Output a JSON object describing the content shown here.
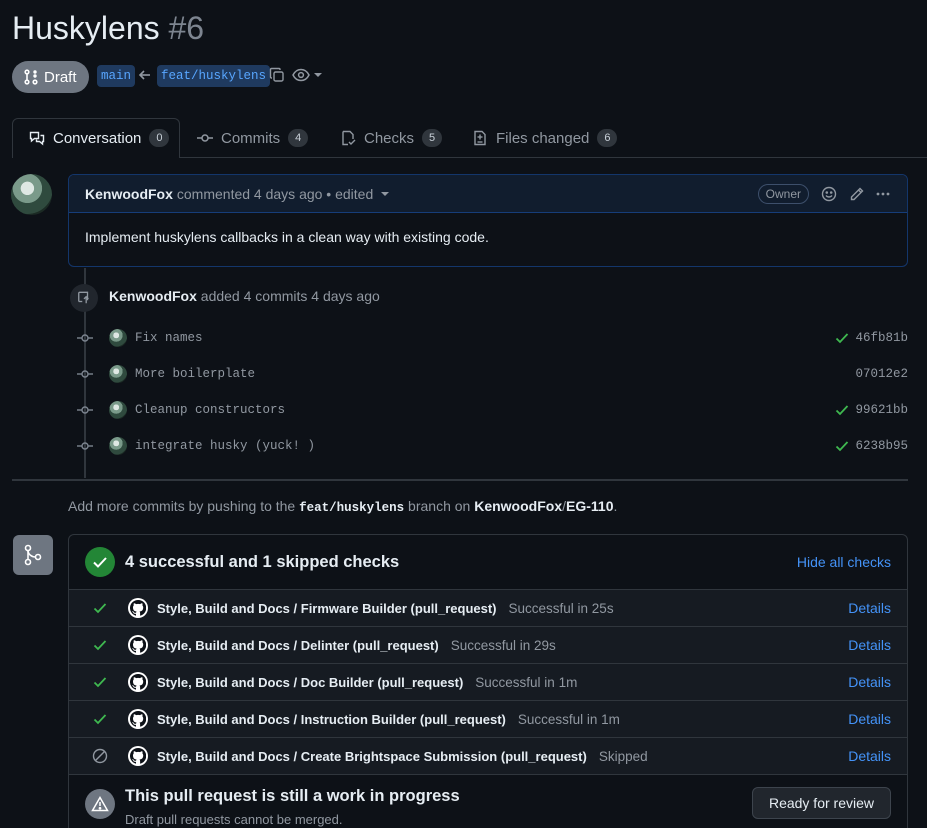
{
  "pr": {
    "title": "Huskylens",
    "number": "#6",
    "state": "Draft",
    "base_branch": "main",
    "head_branch": "feat/huskylens"
  },
  "tabs": [
    {
      "label": "Conversation",
      "count": "0",
      "icon": "comment-discussion-icon"
    },
    {
      "label": "Commits",
      "count": "4",
      "icon": "git-commit-icon"
    },
    {
      "label": "Checks",
      "count": "5",
      "icon": "checklist-icon"
    },
    {
      "label": "Files changed",
      "count": "6",
      "icon": "file-diff-icon"
    }
  ],
  "comment": {
    "author": "KenwoodFox",
    "meta": "commented 4 days ago • edited",
    "role": "Owner",
    "body": "Implement huskylens callbacks in a clean way with existing code."
  },
  "commit_event": {
    "author": "KenwoodFox",
    "text": "added 4 commits 4 days ago"
  },
  "commits": [
    {
      "message": "Fix names",
      "sha": "46fb81b",
      "status": "success"
    },
    {
      "message": "More boilerplate",
      "sha": "07012e2",
      "status": "none"
    },
    {
      "message": "Cleanup constructors",
      "sha": "99621bb",
      "status": "success"
    },
    {
      "message": "integrate husky (yuck! )",
      "sha": "6238b95",
      "status": "success"
    }
  ],
  "push_hint": {
    "prefix": "Add more commits by pushing to the",
    "branch": "feat/huskylens",
    "middle": "branch on",
    "owner": "KenwoodFox",
    "sep": "/",
    "repo": "EG-110",
    "suffix": "."
  },
  "checks_summary": {
    "title": "4 successful and 1 skipped checks",
    "toggle": "Hide all checks"
  },
  "checks": [
    {
      "workflow": "Style, Build and Docs / Firmware Builder (pull_request)",
      "desc": "Successful in 25s",
      "status": "success",
      "link": "Details"
    },
    {
      "workflow": "Style, Build and Docs / Delinter (pull_request)",
      "desc": "Successful in 29s",
      "status": "success",
      "link": "Details"
    },
    {
      "workflow": "Style, Build and Docs / Doc Builder (pull_request)",
      "desc": "Successful in 1m",
      "status": "success",
      "link": "Details"
    },
    {
      "workflow": "Style, Build and Docs / Instruction Builder (pull_request)",
      "desc": "Successful in 1m",
      "status": "success",
      "link": "Details"
    },
    {
      "workflow": "Style, Build and Docs / Create Brightspace Submission (pull_request)",
      "desc": "Skipped",
      "status": "skipped",
      "link": "Details"
    }
  ],
  "wip": {
    "title": "This pull request is still a work in progress",
    "subtitle": "Draft pull requests cannot be merged.",
    "button": "Ready for review"
  },
  "colors": {
    "background": "#0d1117",
    "success": "#3fb950",
    "link": "#4493f8",
    "draft": "#6e7681"
  }
}
